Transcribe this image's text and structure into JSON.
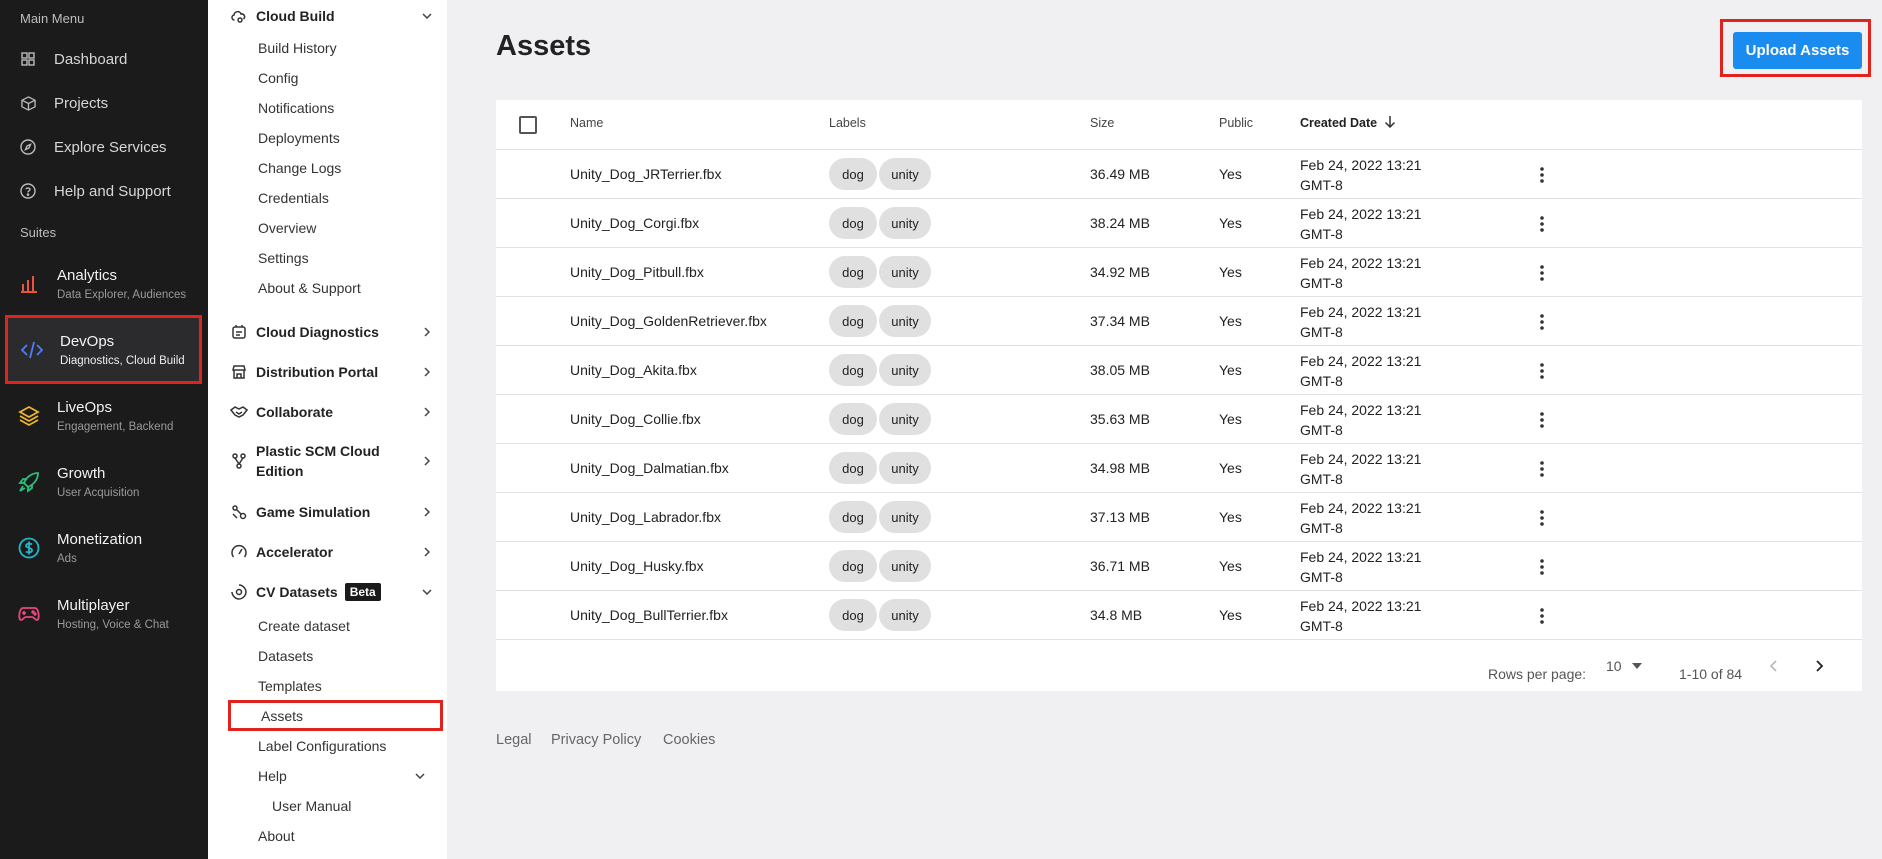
{
  "rail": {
    "main_menu_heading": "Main Menu",
    "main_items": [
      {
        "label": "Dashboard",
        "icon": "grid-icon"
      },
      {
        "label": "Projects",
        "icon": "cube-icon"
      },
      {
        "label": "Explore Services",
        "icon": "compass-icon"
      },
      {
        "label": "Help and Support",
        "icon": "help-circle-icon"
      }
    ],
    "suites_heading": "Suites",
    "suites": [
      {
        "title": "Analytics",
        "subtitle": "Data Explorer, Audiences",
        "icon": "bar-chart-icon",
        "color": "#e8553d"
      },
      {
        "title": "DevOps",
        "subtitle": "Diagnostics, Cloud Build",
        "icon": "code-icon",
        "color": "#4a7dff",
        "active": true
      },
      {
        "title": "LiveOps",
        "subtitle": "Engagement, Backend",
        "icon": "layers-icon",
        "color": "#f0b429"
      },
      {
        "title": "Growth",
        "subtitle": "User Acquisition",
        "icon": "rocket-icon",
        "color": "#2bbf7e"
      },
      {
        "title": "Monetization",
        "subtitle": "Ads",
        "icon": "dollar-circle-icon",
        "color": "#1fb8c9"
      },
      {
        "title": "Multiplayer",
        "subtitle": "Hosting, Voice & Chat",
        "icon": "gamepad-icon",
        "color": "#e8467c"
      }
    ]
  },
  "sidebar": {
    "cloud_build": {
      "label": "Cloud Build",
      "items": [
        "Build History",
        "Config",
        "Notifications",
        "Deployments",
        "Change Logs",
        "Credentials",
        "Overview",
        "Settings",
        "About & Support"
      ]
    },
    "groups": [
      {
        "label": "Cloud Diagnostics",
        "icon": "diagnostics-icon"
      },
      {
        "label": "Distribution Portal",
        "icon": "store-icon"
      },
      {
        "label": "Collaborate",
        "icon": "handshake-icon"
      },
      {
        "label": "Plastic SCM Cloud Edition",
        "icon": "branch-icon"
      },
      {
        "label": "Game Simulation",
        "icon": "simulation-icon"
      },
      {
        "label": "Accelerator",
        "icon": "speedometer-icon"
      }
    ],
    "cv_datasets": {
      "label": "CV Datasets",
      "badge": "Beta",
      "items": [
        "Create dataset",
        "Datasets",
        "Templates",
        "Assets",
        "Label Configurations"
      ],
      "active_item": "Assets",
      "help_label": "Help",
      "help_items": [
        "User Manual"
      ],
      "about_label": "About"
    }
  },
  "main": {
    "title": "Assets",
    "upload_button": "Upload Assets",
    "table": {
      "columns": {
        "name": "Name",
        "labels": "Labels",
        "size": "Size",
        "public": "Public",
        "created": "Created Date"
      },
      "sort_column": "Created Date",
      "sort_direction": "descending",
      "rows": [
        {
          "name": "Unity_Dog_JRTerrier.fbx",
          "labels": [
            "dog",
            "unity"
          ],
          "size": "36.49 MB",
          "public": "Yes",
          "date1": "Feb 24, 2022 13:21",
          "date2": "GMT-8"
        },
        {
          "name": "Unity_Dog_Corgi.fbx",
          "labels": [
            "dog",
            "unity"
          ],
          "size": "38.24 MB",
          "public": "Yes",
          "date1": "Feb 24, 2022 13:21",
          "date2": "GMT-8"
        },
        {
          "name": "Unity_Dog_Pitbull.fbx",
          "labels": [
            "dog",
            "unity"
          ],
          "size": "34.92 MB",
          "public": "Yes",
          "date1": "Feb 24, 2022 13:21",
          "date2": "GMT-8"
        },
        {
          "name": "Unity_Dog_GoldenRetriever.fbx",
          "labels": [
            "dog",
            "unity"
          ],
          "size": "37.34 MB",
          "public": "Yes",
          "date1": "Feb 24, 2022 13:21",
          "date2": "GMT-8"
        },
        {
          "name": "Unity_Dog_Akita.fbx",
          "labels": [
            "dog",
            "unity"
          ],
          "size": "38.05 MB",
          "public": "Yes",
          "date1": "Feb 24, 2022 13:21",
          "date2": "GMT-8"
        },
        {
          "name": "Unity_Dog_Collie.fbx",
          "labels": [
            "dog",
            "unity"
          ],
          "size": "35.63 MB",
          "public": "Yes",
          "date1": "Feb 24, 2022 13:21",
          "date2": "GMT-8"
        },
        {
          "name": "Unity_Dog_Dalmatian.fbx",
          "labels": [
            "dog",
            "unity"
          ],
          "size": "34.98 MB",
          "public": "Yes",
          "date1": "Feb 24, 2022 13:21",
          "date2": "GMT-8"
        },
        {
          "name": "Unity_Dog_Labrador.fbx",
          "labels": [
            "dog",
            "unity"
          ],
          "size": "37.13 MB",
          "public": "Yes",
          "date1": "Feb 24, 2022 13:21",
          "date2": "GMT-8"
        },
        {
          "name": "Unity_Dog_Husky.fbx",
          "labels": [
            "dog",
            "unity"
          ],
          "size": "36.71 MB",
          "public": "Yes",
          "date1": "Feb 24, 2022 13:21",
          "date2": "GMT-8"
        },
        {
          "name": "Unity_Dog_BullTerrier.fbx",
          "labels": [
            "dog",
            "unity"
          ],
          "size": "34.8 MB",
          "public": "Yes",
          "date1": "Feb 24, 2022 13:21",
          "date2": "GMT-8"
        }
      ]
    },
    "pagination": {
      "rows_per_page_label": "Rows per page:",
      "rows_per_page": "10",
      "range": "1-10 of 84"
    }
  },
  "footer": {
    "links": [
      "Legal",
      "Privacy Policy",
      "Cookies"
    ]
  },
  "colors": {
    "accent_blue": "#1a8cf0",
    "highlight_red": "#e0231c",
    "rail_bg": "#1b1b1b"
  }
}
